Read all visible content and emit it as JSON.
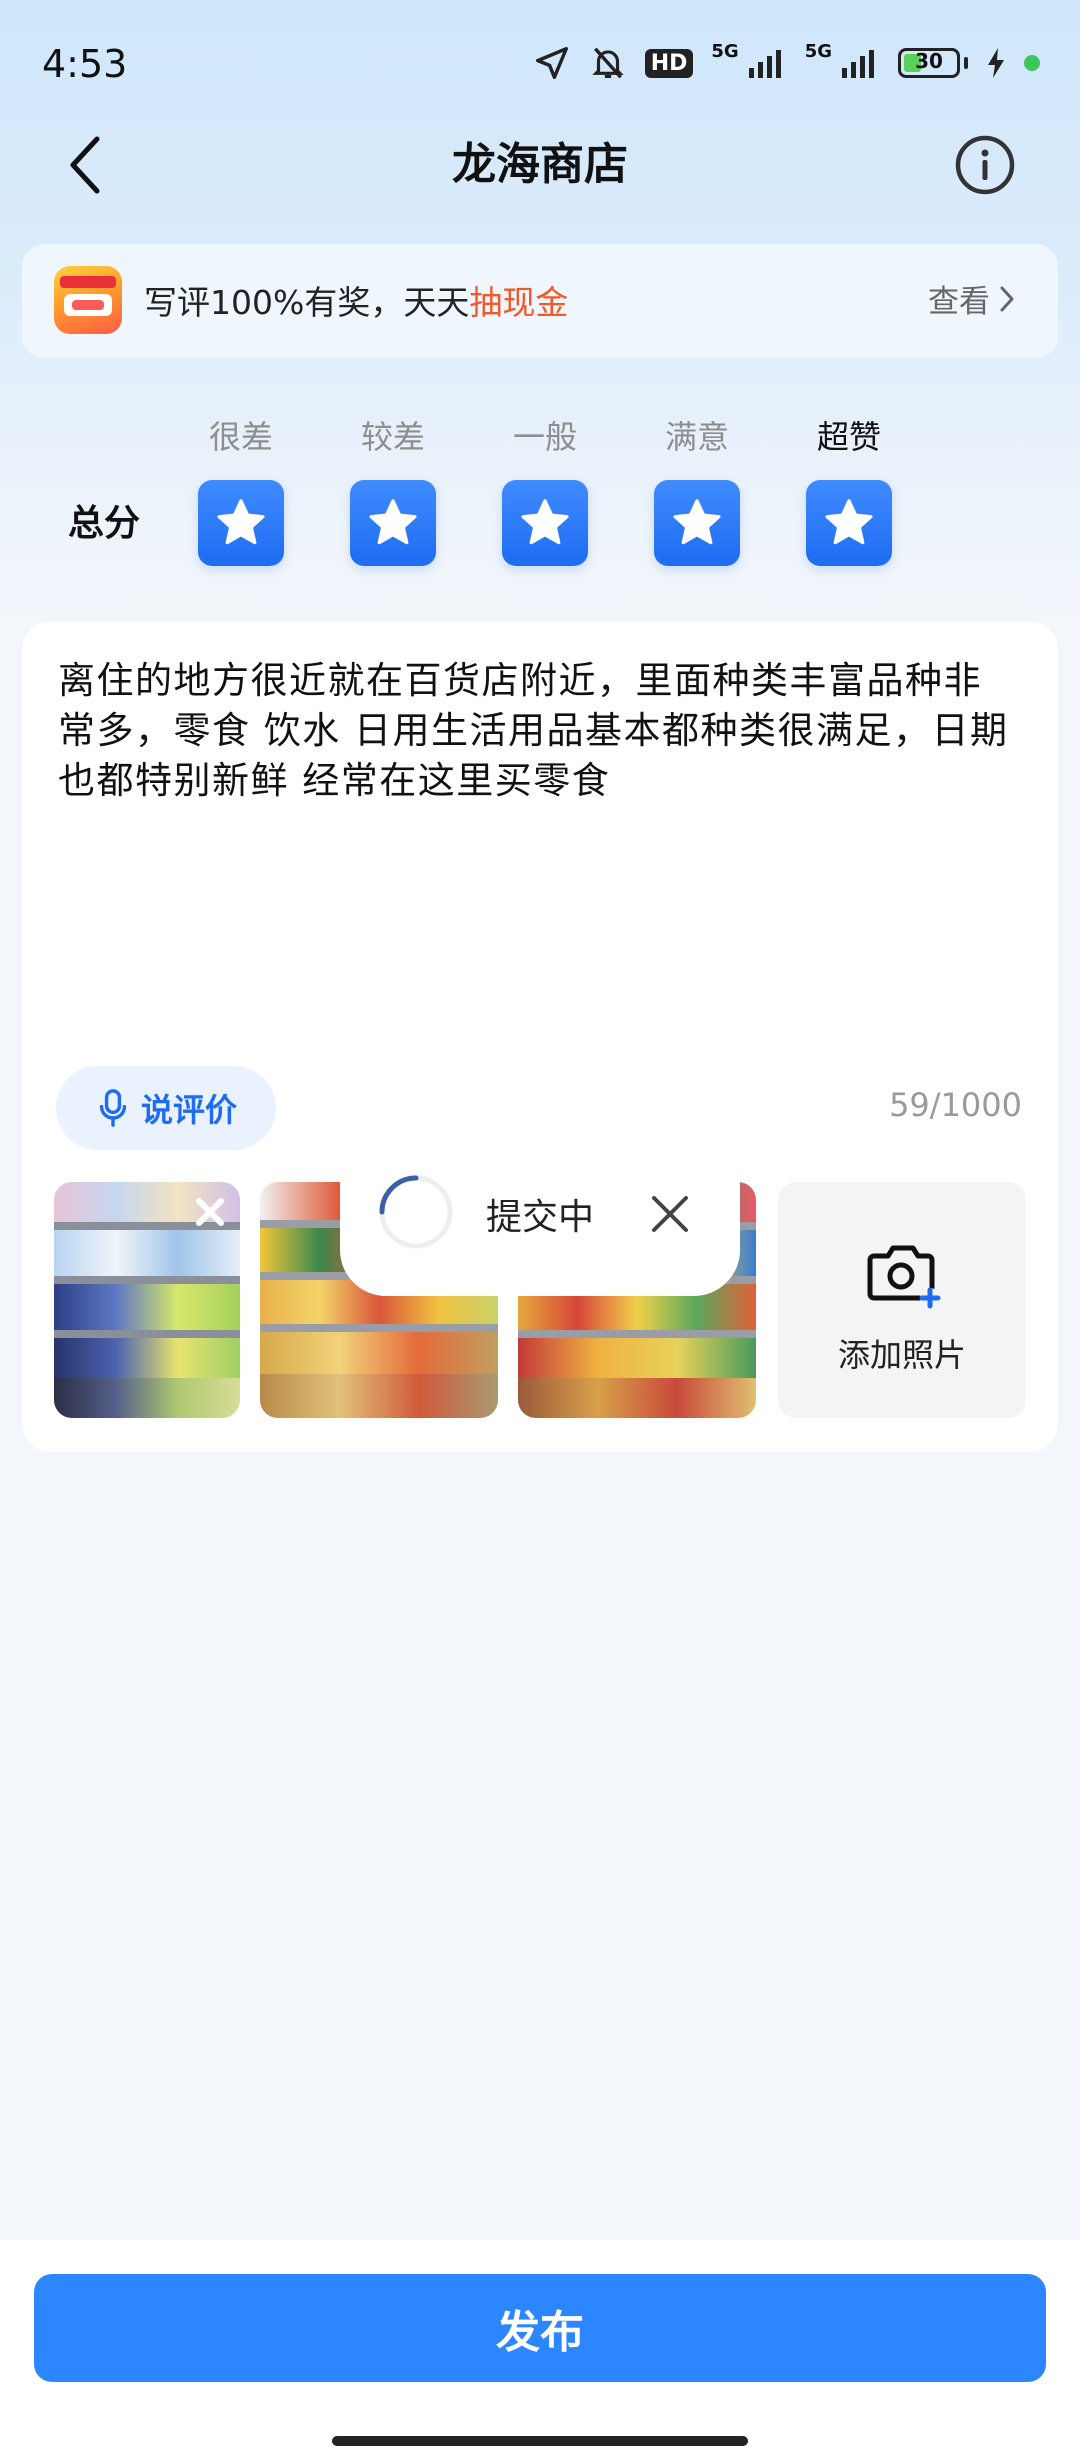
{
  "status_bar": {
    "time": "4:53",
    "hd_label": "HD",
    "network_label_1": "5G",
    "network_label_2": "5G",
    "battery_level": "30"
  },
  "header": {
    "title": "龙海商店"
  },
  "promo": {
    "text_prefix": "写评100%有奖，天天",
    "text_highlight": "抽现金",
    "link_label": "查看"
  },
  "rating": {
    "label": "总分",
    "options": [
      "很差",
      "较差",
      "一般",
      "满意",
      "超赞"
    ],
    "selected": "超赞",
    "stars_selected": 5
  },
  "review": {
    "text": "离住的地方很近就在百货店附近，里面种类丰富品种非常多，零食 饮水 日用生活用品基本都种类很满足，日期也都特别新鲜 经常在这里买零食",
    "voice_button_label": "说评价",
    "char_count": "59/1000",
    "add_photo_label": "添加照片"
  },
  "toast": {
    "text": "提交中"
  },
  "bottom": {
    "publish_label": "发布"
  },
  "colors": {
    "accent": "#1f6cf2",
    "button": "#2b86ff",
    "highlight": "#f05a28"
  }
}
